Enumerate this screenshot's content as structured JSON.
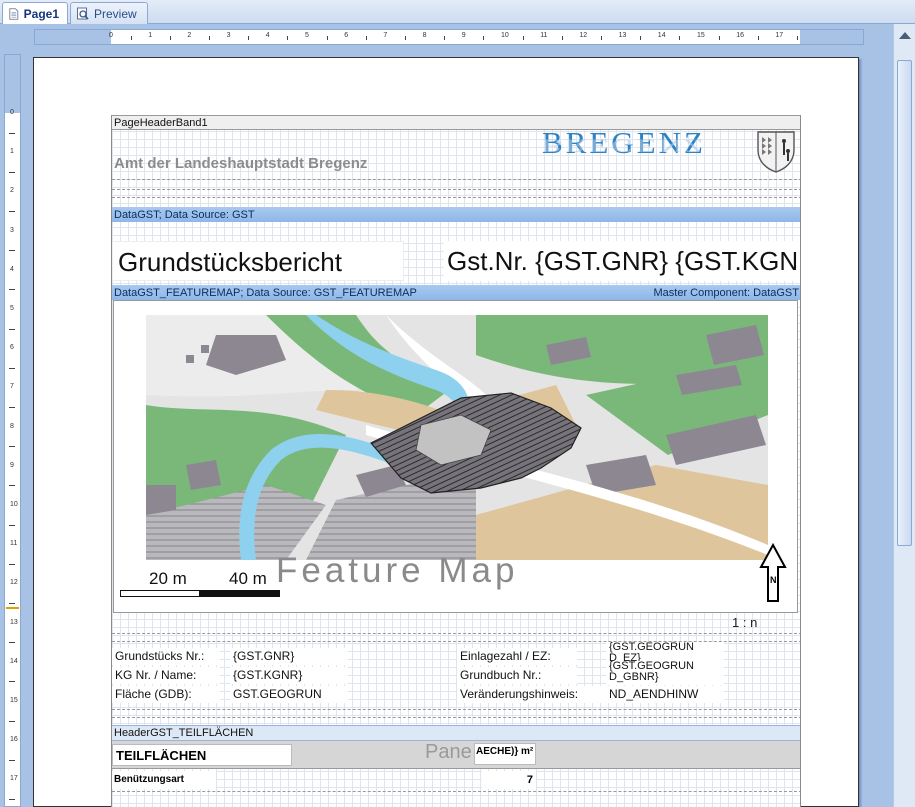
{
  "tabs": [
    {
      "label": "Page1",
      "icon": "page-icon",
      "active": true
    },
    {
      "label": "Preview",
      "icon": "magnifier-icon",
      "active": false
    }
  ],
  "ruler": {
    "h_labels": [
      "0",
      "1",
      "2",
      "3",
      "4",
      "5",
      "6",
      "7",
      "8",
      "9",
      "10",
      "11",
      "12",
      "13",
      "14",
      "15",
      "16",
      "17"
    ],
    "v_labels": [
      "0",
      "1",
      "2",
      "3",
      "4",
      "5",
      "6",
      "7",
      "8",
      "9",
      "10",
      "11",
      "12",
      "13",
      "14",
      "15",
      "16",
      "17"
    ]
  },
  "report": {
    "page_header_band": "PageHeaderBand1",
    "amt_text": "Amt der Landeshauptstadt Bregenz",
    "logo_text": "BREGENZ",
    "data_band": "DataGST; Data Source: GST",
    "title": "Grundstücksbericht",
    "gst_nr": "Gst.Nr.  {GST.GNR}  {GST.KGNR}",
    "featuremap_band": "DataGST_FEATUREMAP; Data Source: GST_FEATUREMAP",
    "master_component": "Master Component: DataGST",
    "feature_map": "Feature Map",
    "scale_20": "20 m",
    "scale_40": "40 m",
    "north_letter": "N",
    "ratio": "1 : n",
    "fields": {
      "grundstuecks_nr_label": "Grundstücks Nr.:",
      "grundstuecks_nr_value": "{GST.GNR}",
      "kg_label": "KG Nr. / Name:",
      "kg_value": "{GST.KGNR}",
      "flaeche_label": "Fläche (GDB):",
      "flaeche_value": "GST.GEOGRUN",
      "einlage_label": "Einlagezahl / EZ:",
      "einlage_value_1": "{GST.GEOGRUN",
      "einlage_value_2": "D_EZ}",
      "grundbuch_label": "Grundbuch Nr.:",
      "grundbuch_value_1": "{GST.GEOGRUN",
      "grundbuch_value_2": "D_GBNR}",
      "veraenderung_label": "Veränderungshinweis:",
      "veraenderung_value": "ND_AENDHINW"
    },
    "header_teilflaechen": "HeaderGST_TEILFLÄCHEN",
    "teilflaechen": "TEILFLÄCHEN",
    "panel_text": "Pane",
    "aeche_text": "AECHE)} m²",
    "benuetzungsart": "Benützungsart",
    "count": "7"
  },
  "colors": {
    "blue_band": "#8db7e8",
    "logo_blue": "#2e82c3",
    "map_green": "#7ab87a",
    "map_water": "#8ed1ee",
    "map_sand": "#dfc59b",
    "map_building": "#8d8792"
  }
}
